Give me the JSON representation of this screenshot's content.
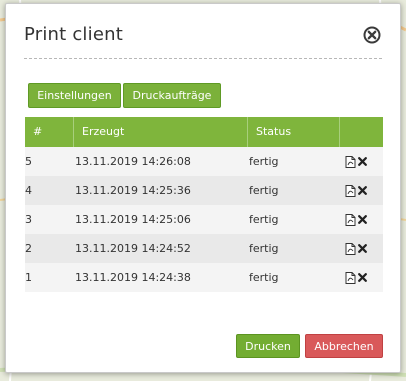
{
  "dialog": {
    "title": "Print client"
  },
  "tabs": {
    "settings_label": "Einstellungen",
    "jobs_label": "Druckaufträge"
  },
  "table": {
    "headers": [
      "#",
      "Erzeugt",
      "Status",
      ""
    ],
    "rows": [
      {
        "id": "5",
        "created": "13.11.2019 14:26:08",
        "status": "fertig"
      },
      {
        "id": "4",
        "created": "13.11.2019 14:25:36",
        "status": "fertig"
      },
      {
        "id": "3",
        "created": "13.11.2019 14:25:06",
        "status": "fertig"
      },
      {
        "id": "2",
        "created": "13.11.2019 14:24:52",
        "status": "fertig"
      },
      {
        "id": "1",
        "created": "13.11.2019 14:24:38",
        "status": "fertig"
      }
    ]
  },
  "footer": {
    "print_label": "Drucken",
    "cancel_label": "Abbrechen"
  },
  "icons": {
    "close": "close-circle-icon",
    "pdf": "pdf-file-icon",
    "delete": "delete-x-icon"
  },
  "colors": {
    "accent_green": "#7fb53c",
    "danger_red": "#d9595a"
  }
}
